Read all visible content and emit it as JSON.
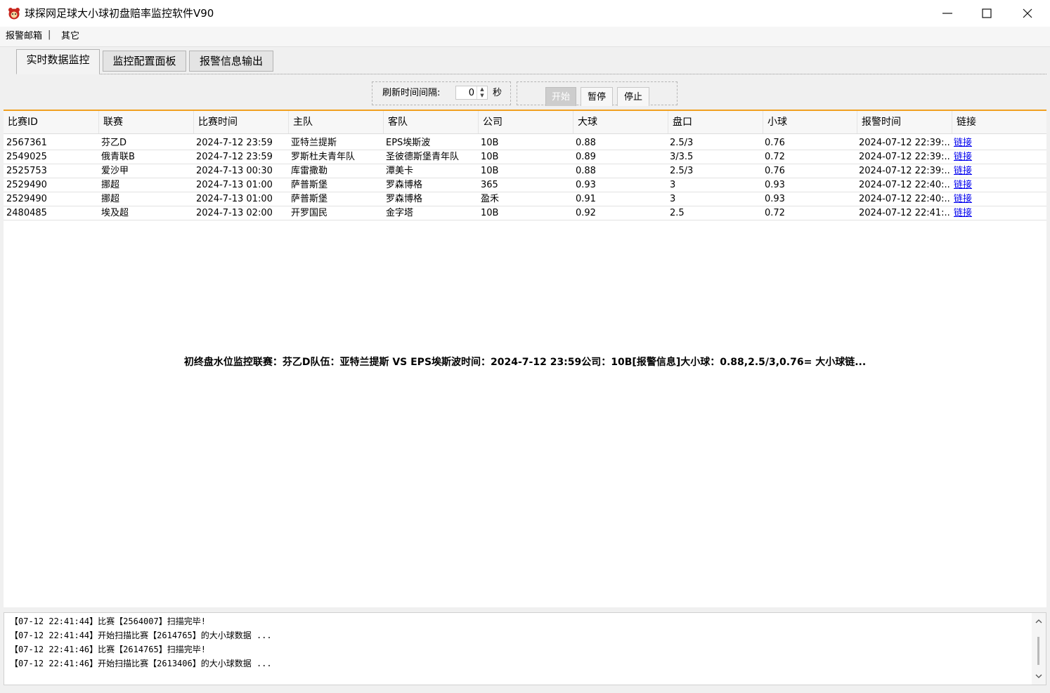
{
  "window": {
    "title": "球探网足球大小球初盘赔率监控软件V90"
  },
  "menu": {
    "items": [
      "报警邮箱",
      "其它"
    ],
    "separator": "|"
  },
  "tabs": [
    {
      "label": "实时数据监控",
      "active": true
    },
    {
      "label": "监控配置面板",
      "active": false
    },
    {
      "label": "报警信息输出",
      "active": false
    }
  ],
  "refresh": {
    "label": "刷新时间间隔:",
    "value": "0",
    "unit": "秒"
  },
  "controls": {
    "start": "开始",
    "pause": "暂停",
    "stop": "停止"
  },
  "grid": {
    "headers": [
      "比赛ID",
      "联赛",
      "比赛时间",
      "主队",
      "客队",
      "公司",
      "大球",
      "盘口",
      "小球",
      "报警时间",
      "链接"
    ],
    "rows": [
      [
        "2567361",
        "芬乙D",
        "2024-7-12 23:59",
        "亚特兰提斯",
        "EPS埃斯波",
        "10B",
        "0.88",
        "2.5/3",
        "0.76",
        "2024-07-12 22:39:...",
        "链接"
      ],
      [
        "2549025",
        "俄青联B",
        "2024-7-12 23:59",
        "罗斯杜夫青年队",
        "圣彼德斯堡青年队",
        "10B",
        "0.89",
        "3/3.5",
        "0.72",
        "2024-07-12 22:39:...",
        "链接"
      ],
      [
        "2525753",
        "爱沙甲",
        "2024-7-13 00:30",
        "库雷撒勒",
        "潭美卡",
        "10B",
        "0.88",
        "2.5/3",
        "0.76",
        "2024-07-12 22:39:...",
        "链接"
      ],
      [
        "2529490",
        "挪超",
        "2024-7-13 01:00",
        "萨普斯堡",
        "罗森博格",
        "365",
        "0.93",
        "3",
        "0.93",
        "2024-07-12 22:40:...",
        "链接"
      ],
      [
        "2529490",
        "挪超",
        "2024-7-13 01:00",
        "萨普斯堡",
        "罗森博格",
        "盈禾",
        "0.91",
        "3",
        "0.93",
        "2024-07-12 22:40:...",
        "链接"
      ],
      [
        "2480485",
        "埃及超",
        "2024-7-13 02:00",
        "开罗国民",
        "金字塔",
        "10B",
        "0.92",
        "2.5",
        "0.72",
        "2024-07-12 22:41:...",
        "链接"
      ]
    ]
  },
  "alert": {
    "text": "初终盘水位监控联赛：芬乙D队伍：亚特兰提斯 VS EPS埃斯波时间：2024-7-12 23:59公司：10B[报警信息]大小球：0.88,2.5/3,0.76=  大小球链..."
  },
  "log": {
    "lines": [
      "【07-12 22:41:44】比赛【2564007】扫描完毕!",
      "【07-12 22:41:44】开始扫描比赛【2614765】的大小球数据 ...",
      "【07-12 22:41:46】比赛【2614765】扫描完毕!",
      "【07-12 22:41:46】开始扫描比赛【2613406】的大小球数据 ..."
    ]
  }
}
